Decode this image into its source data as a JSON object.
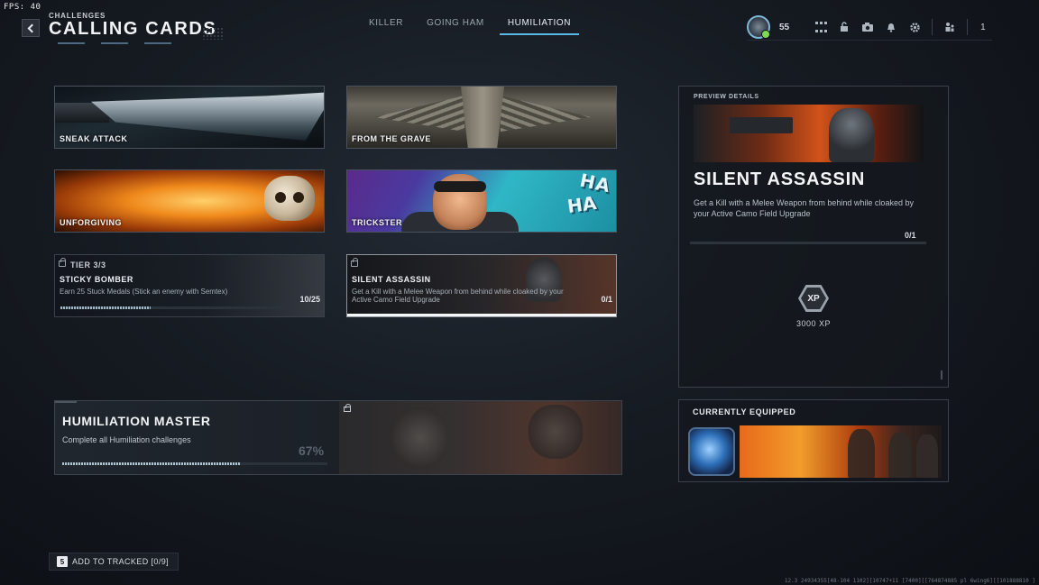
{
  "fps": "FPS:  40",
  "header": {
    "breadcrumb": "CHALLENGES",
    "title": "CALLING CARDS"
  },
  "tabs": [
    {
      "label": "KILLER",
      "active": false
    },
    {
      "label": "GOING HAM",
      "active": false
    },
    {
      "label": "HUMILIATION",
      "active": true
    }
  ],
  "topbar": {
    "level": "55",
    "party_count": "1",
    "icons": [
      "grid-icon",
      "lock-icon",
      "camera-icon",
      "bell-icon",
      "gear-icon",
      "party-icon"
    ]
  },
  "calling_cards": [
    {
      "label": "SNEAK ATTACK"
    },
    {
      "label": "FROM THE GRAVE"
    },
    {
      "label": "UNFORGIVING"
    },
    {
      "label": "TRICKSTER",
      "art_text": "HA"
    }
  ],
  "challenges": [
    {
      "tier": "TIER 3/3",
      "name": "STICKY BOMBER",
      "description": "Earn 25 Stuck Medals (Stick an enemy with Semtex)",
      "progress": "10/25",
      "progress_fraction": 0.4
    },
    {
      "name": "SILENT ASSASSIN",
      "description": "Get a Kill with a Melee Weapon from behind while cloaked by your Active Camo Field Upgrade",
      "progress": "0/1",
      "progress_fraction": 0
    }
  ],
  "master": {
    "title": "HUMILIATION MASTER",
    "description": "Complete all Humiliation challenges",
    "percent": "67%",
    "progress_fraction": 0.67
  },
  "preview": {
    "header": "PREVIEW DETAILS",
    "title": "SILENT ASSASSIN",
    "description": "Get a Kill with a Melee Weapon from behind while cloaked by your Active Camo Field Upgrade",
    "progress": "0/1",
    "reward_badge": "XP",
    "reward": "3000 XP"
  },
  "equipped": {
    "header": "CURRENTLY EQUIPPED"
  },
  "footer": {
    "key": "5",
    "track_label": "ADD TO TRACKED [0/9]",
    "build": "12.3 24934355[48-104 1102][10747+11 [7400][[764874885 pl 6wing6][[101888810 ]"
  },
  "colors": {
    "accent": "#58b9e6",
    "background": "#161b22",
    "border": "#3a414b"
  }
}
